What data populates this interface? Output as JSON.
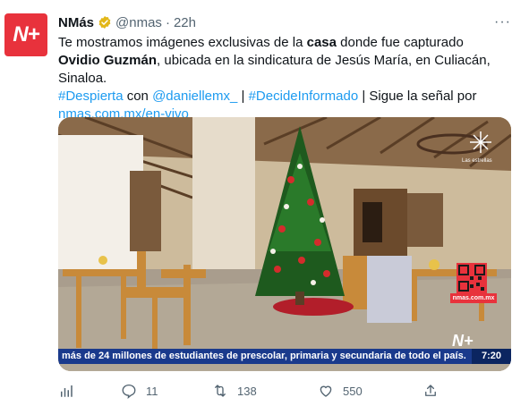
{
  "account": {
    "name": "NMás",
    "handle": "@nmas",
    "separator": "·",
    "time": "22h",
    "avatar_text": "N+"
  },
  "tweet": {
    "text_1": "Te mostramos imágenes exclusivas de la ",
    "text_bold_1": "casa",
    "text_2": " donde fue capturado ",
    "text_bold_2": "Ovidio Guzmán",
    "text_3": ", ubicada en la sindicatura de Jesús María, en Culiacán, Sinaloa.",
    "hashtag_1": "#Despierta",
    "text_4": " con ",
    "mention_1": "@daniellemx_",
    "text_5": " | ",
    "hashtag_2": "#DecideInformado",
    "text_6": " | Sigue la señal por",
    "url": "nmas.com.mx/en-vivo"
  },
  "media": {
    "ticker_text": "más de 24 millones de estudiantes de prescolar, primaria y secundaria de todo el país.",
    "clock": "7:20",
    "watermark": "N+",
    "site_label": "nmas.com.mx",
    "corner_label": "Las estrellas"
  },
  "actions": {
    "replies": "11",
    "retweets": "138",
    "likes": "550"
  },
  "colors": {
    "brand": "#e8323c",
    "link": "#1d9bf0",
    "ticker": "#1a3a8c"
  }
}
